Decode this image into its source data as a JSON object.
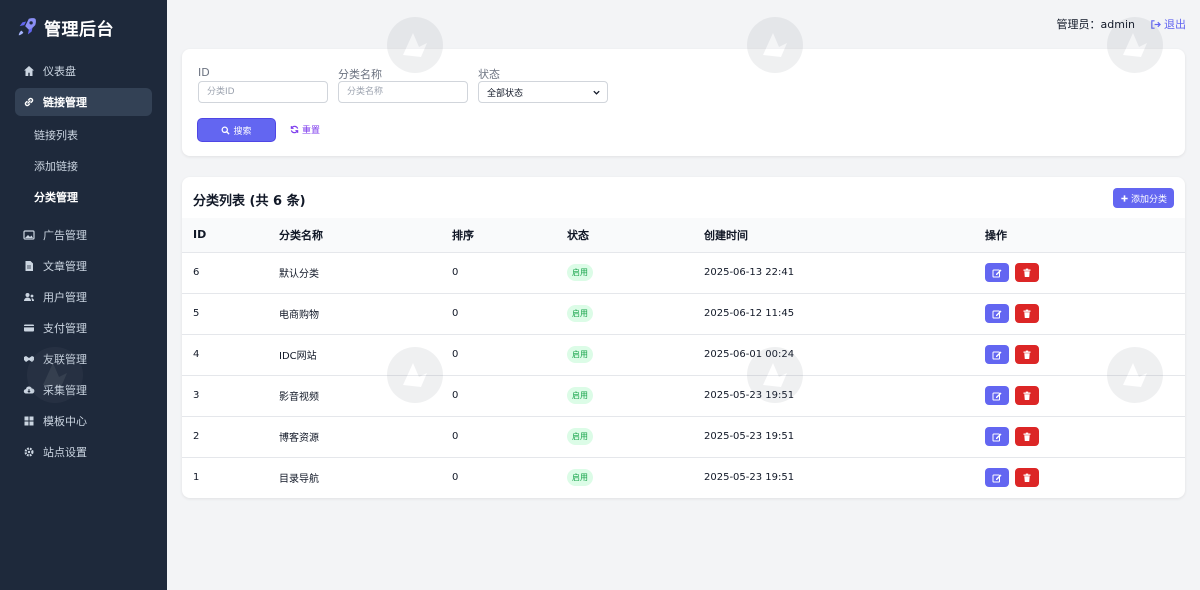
{
  "brand": {
    "title": "管理后台",
    "logo_icon": "rocket-icon"
  },
  "sidebar": {
    "items": [
      {
        "label": "仪表盘",
        "icon": "home-icon"
      },
      {
        "label": "链接管理",
        "icon": "link-icon",
        "active": true
      },
      {
        "label": "广告管理",
        "icon": "image-icon"
      },
      {
        "label": "文章管理",
        "icon": "file-icon"
      },
      {
        "label": "用户管理",
        "icon": "users-icon"
      },
      {
        "label": "支付管理",
        "icon": "credit-card-icon"
      },
      {
        "label": "友联管理",
        "icon": "handshake-icon"
      },
      {
        "label": "采集管理",
        "icon": "cloud-download-icon"
      },
      {
        "label": "模板中心",
        "icon": "grid-icon"
      },
      {
        "label": "站点设置",
        "icon": "gear-icon"
      }
    ],
    "sub_items": [
      {
        "label": "链接列表"
      },
      {
        "label": "添加链接"
      },
      {
        "label": "分类管理",
        "current": true
      }
    ]
  },
  "topbar": {
    "admin_label": "管理员：admin",
    "logout_label": "退出"
  },
  "filter": {
    "id_label": "ID",
    "id_placeholder": "分类ID",
    "name_label": "分类名称",
    "name_placeholder": "分类名称",
    "status_label": "状态",
    "status_value": "全部状态",
    "search_label": "搜索",
    "reset_label": "重置"
  },
  "list": {
    "title": "分类列表 (共 6 条)",
    "add_label": "添加分类",
    "columns": [
      "ID",
      "分类名称",
      "排序",
      "状态",
      "创建时间",
      "操作"
    ],
    "rows": [
      {
        "id": "6",
        "name": "默认分类",
        "sort": "0",
        "status": "启用",
        "created": "2025-06-13 22:41"
      },
      {
        "id": "5",
        "name": "电商购物",
        "sort": "0",
        "status": "启用",
        "created": "2025-06-12 11:45"
      },
      {
        "id": "4",
        "name": "IDC网站",
        "sort": "0",
        "status": "启用",
        "created": "2025-06-01 00:24"
      },
      {
        "id": "3",
        "name": "影音视频",
        "sort": "0",
        "status": "启用",
        "created": "2025-05-23 19:51"
      },
      {
        "id": "2",
        "name": "博客资源",
        "sort": "0",
        "status": "启用",
        "created": "2025-05-23 19:51"
      },
      {
        "id": "1",
        "name": "目录导航",
        "sort": "0",
        "status": "启用",
        "created": "2025-05-23 19:51"
      }
    ]
  },
  "colors": {
    "sidebar_bg": "#1e293b",
    "accent": "#6366f1",
    "danger": "#dc2626",
    "success": "#16a34a"
  }
}
